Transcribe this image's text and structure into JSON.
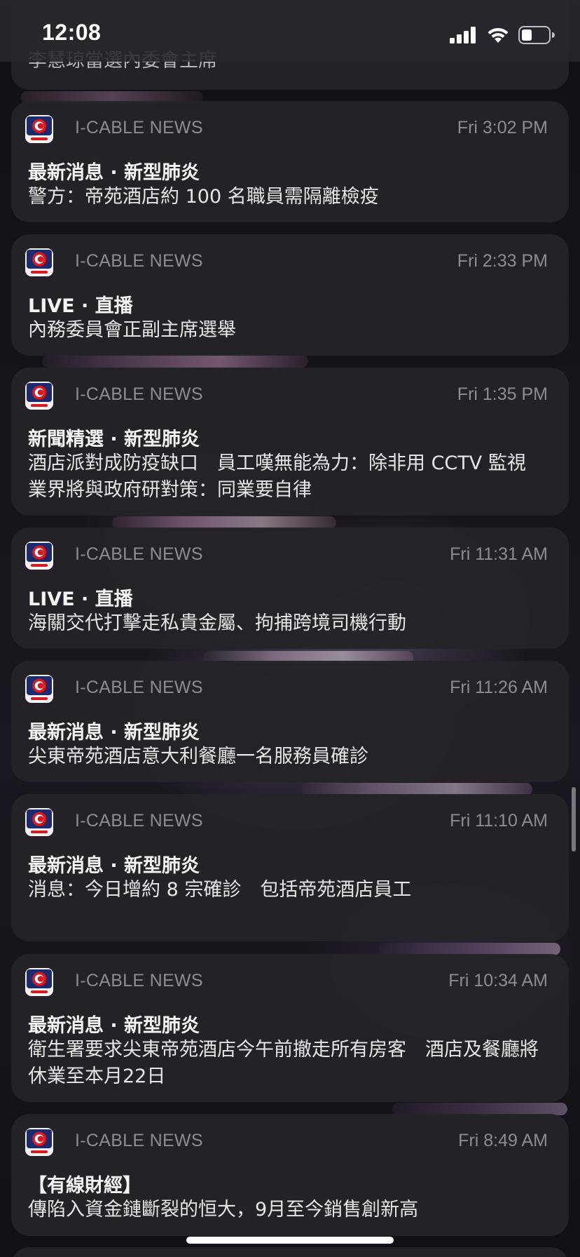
{
  "status_bar": {
    "time": "12:08"
  },
  "colors": {
    "card_bg": "#242328",
    "meta_text": "#8e8c93",
    "title_text": "#f4f4f5",
    "app_icon_accent": "#d71920"
  },
  "partial_notification": {
    "body": "李慧琼當選內委會主席"
  },
  "notifications": [
    {
      "app": "I-CABLE NEWS",
      "time": "Fri 3:02 PM",
      "title": "最新消息 · 新型肺炎",
      "body": "警方：帝苑酒店約 100 名職員需隔離檢疫"
    },
    {
      "app": "I-CABLE NEWS",
      "time": "Fri 2:33 PM",
      "title": "LIVE · 直播",
      "body": "內務委員會正副主席選舉"
    },
    {
      "app": "I-CABLE NEWS",
      "time": "Fri 1:35 PM",
      "title": "新聞精選 · 新型肺炎",
      "body": "酒店派對成防疫缺口　員工嘆無能為力：除非用 CCTV 監視　業界將與政府研對策：同業要自律"
    },
    {
      "app": "I-CABLE NEWS",
      "time": "Fri 11:31 AM",
      "title": "LIVE · 直播",
      "body": "海關交代打擊走私貴金屬、拘捕跨境司機行動"
    },
    {
      "app": "I-CABLE NEWS",
      "time": "Fri 11:26 AM",
      "title": "最新消息 · 新型肺炎",
      "body": "尖東帝苑酒店意大利餐廳一名服務員確診"
    },
    {
      "app": "I-CABLE NEWS",
      "time": "Fri 11:10 AM",
      "title": "最新消息 · 新型肺炎",
      "body": "消息：今日增約 8 宗確診　包括帝苑酒店員工"
    },
    {
      "app": "I-CABLE NEWS",
      "time": "Fri 10:34 AM",
      "title": "最新消息 · 新型肺炎",
      "body": "衛生署要求尖東帝苑酒店今午前撤走所有房客　酒店及餐廳將休業至本月22日"
    },
    {
      "app": "I-CABLE NEWS",
      "time": "Fri 8:49 AM",
      "title": "【有線財經】",
      "body": "傳陷入資金鏈斷裂的恒大，9月至今銷售創新高"
    }
  ]
}
